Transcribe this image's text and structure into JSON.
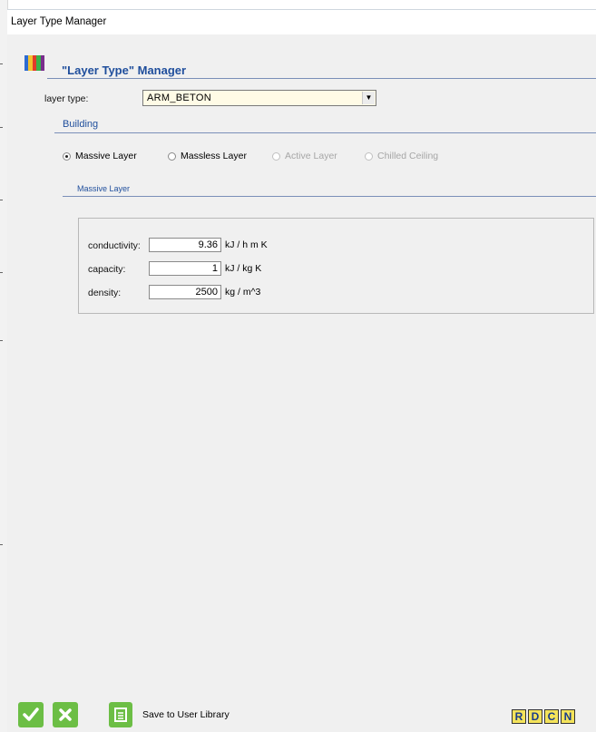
{
  "window": {
    "title": "Layer Type Manager"
  },
  "header": {
    "title": "\"Layer Type\" Manager",
    "logo_colors": [
      "#2d6bd2",
      "#f2c230",
      "#e23b2a",
      "#3ab34a",
      "#7a2e8c"
    ]
  },
  "layer_type": {
    "label": "layer type:",
    "value": "ARM_BETON",
    "dropdown_icon": "chevron-down-icon"
  },
  "section": {
    "title": "Building"
  },
  "radios": [
    {
      "label": "Massive Layer",
      "checked": true,
      "enabled": true
    },
    {
      "label": "Massless Layer",
      "checked": false,
      "enabled": true
    },
    {
      "label": "Active Layer",
      "checked": false,
      "enabled": false
    },
    {
      "label": "Chilled Ceiling",
      "checked": false,
      "enabled": false
    }
  ],
  "subsection": {
    "title": "Massive Layer"
  },
  "fields": [
    {
      "label": "conductivity:",
      "value": "9.36",
      "unit": "kJ / h m K"
    },
    {
      "label": "capacity:",
      "value": "1",
      "unit": "kJ / kg K"
    },
    {
      "label": "density:",
      "value": "2500",
      "unit": "kg / m^3"
    }
  ],
  "footer": {
    "ok_icon": "check-icon",
    "cancel_icon": "close-icon",
    "save_icon": "document-icon",
    "save_label": "Save to User Library",
    "toolbar_letters": [
      "R",
      "D",
      "C",
      "N"
    ],
    "accent_green": "#6cbe45"
  }
}
